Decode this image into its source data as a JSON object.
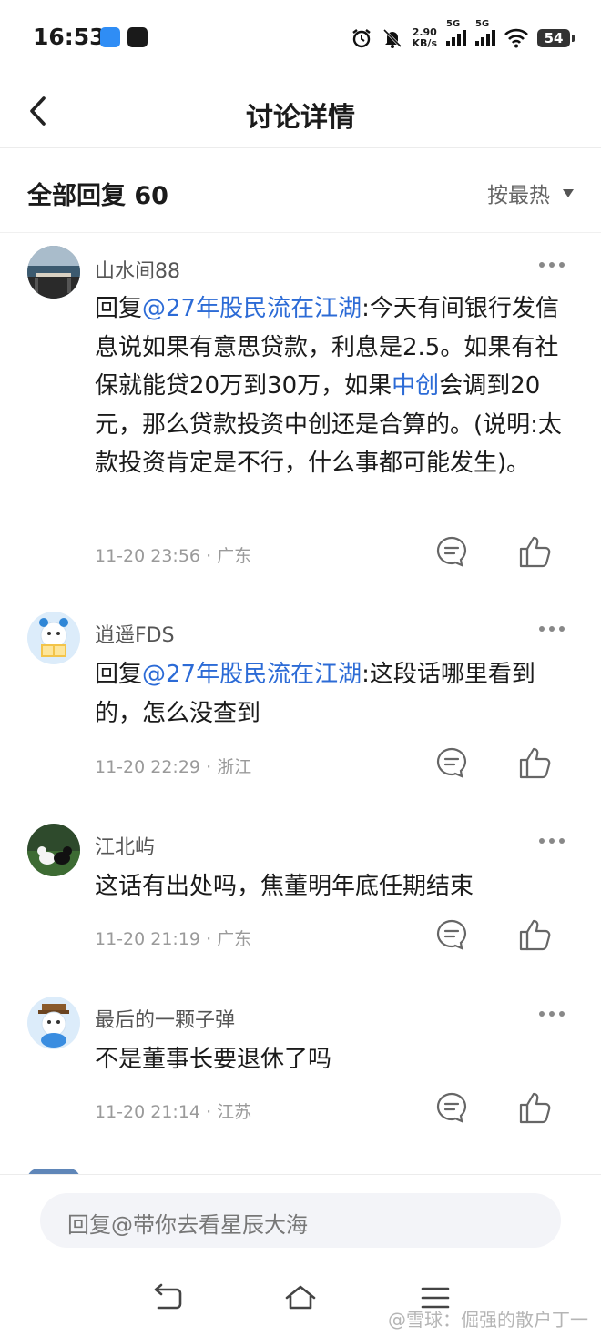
{
  "status_bar": {
    "time": "16:53",
    "net_speed_value": "2.90",
    "net_speed_unit": "KB/s",
    "sim1_label": "5G",
    "sim2_label": "5G",
    "battery": "54"
  },
  "nav": {
    "title": "讨论详情"
  },
  "replies_header": {
    "title": "全部回复 60",
    "sort_label": "按最热"
  },
  "comments": [
    {
      "username": "山水间88",
      "reply_prefix": "回复",
      "mention": "@27年股民流在江湖",
      "text_1": ":今天有间银行发信息说如果有意思贷款，利息是2.5。如果有社保就能贷20万到30万，如果",
      "mention_2": "中创",
      "text_2": "会调到20元，那么贷款投资中创还是合算的。(说明:太款投资肯定是不行，什么事都可能发生)。",
      "time": "11-20 23:56",
      "location": "广东"
    },
    {
      "username": "逍遥FDS",
      "reply_prefix": "回复",
      "mention": "@27年股民流在江湖",
      "text_1": ":这段话哪里看到的，怎么没查到",
      "time": "11-20 22:29",
      "location": "浙江"
    },
    {
      "username": "江北屿",
      "text_1": "这话有出处吗，焦董明年底任期结束",
      "time": "11-20 21:19",
      "location": "广东"
    },
    {
      "username": "最后的一颗子弹",
      "text_1": "不是董事长要退休了吗",
      "time": "11-20 21:14",
      "location": "江苏"
    }
  ],
  "meta_separator": "·",
  "reply_input": {
    "placeholder": "回复@带你去看星辰大海"
  },
  "watermark": "@雪球：倔强的散户丁一"
}
